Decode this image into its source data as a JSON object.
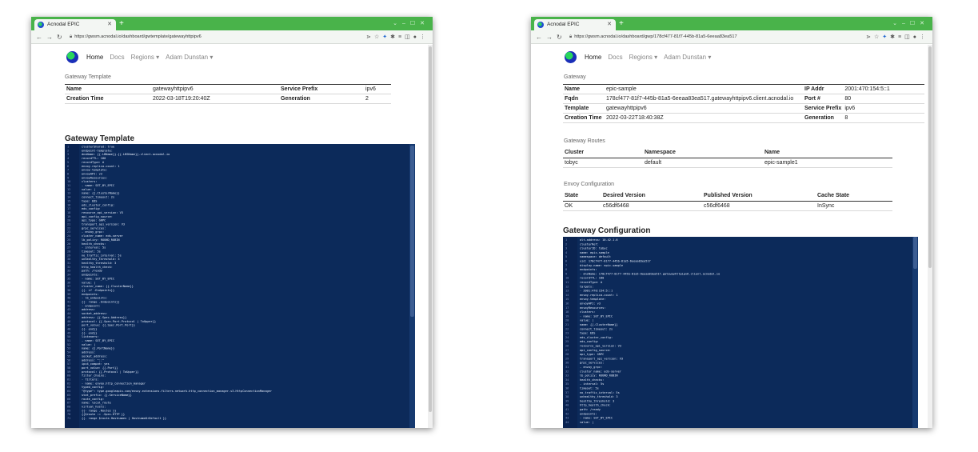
{
  "window1": {
    "tab_title": "Acnodal EPIC",
    "url": "https://gwsm.acnodal.io/dashboard/gwtemplate/gatewayhttpipv6",
    "nav": {
      "home": "Home",
      "docs": "Docs",
      "regions": "Regions ▾",
      "user": "Adam Dunstan ▾"
    },
    "section_label": "Gateway Template",
    "info": {
      "name_label": "Name",
      "name_value": "gatewayhttpipv6",
      "service_prefix_label": "Service Prefix",
      "service_prefix_value": "ipv6",
      "creation_time_label": "Creation Time",
      "creation_time_value": "2022-03-18T19:20:40Z",
      "generation_label": "Generation",
      "generation_value": "2"
    },
    "code_title": "Gateway Template",
    "code_lines": [
      "  clusterShared: true",
      "  endpoint-template:",
      "    dnsName: {{.LBName}}.{{.LBSName}}.client.acnodal.io",
      "    recordTTL: 180",
      "    recordType: A",
      "  envoy-replica-count: 1",
      "  envoy-template:",
      "    envoyAPI: v3",
      "    envoyResources:",
      "      clusters:",
      "      - name: SET_BY_EPIC",
      "        value: |",
      "          name: {{.ClusterName}}",
      "          connect_timeout: 2s",
      "          type: EDS",
      "          eds_cluster_config:",
      "            eds_config:",
      "              resource_api_version: V3",
      "              api_config_source:",
      "                api_type: GRPC",
      "                transport_api_version: V3",
      "                grpc_services:",
      "                - envoy_grpc:",
      "                    cluster_name: eds-server",
      "          lb_policy: ROUND_ROBIN",
      "          health_checks:",
      "          - interval: 5s",
      "            timeout: 5s",
      "            no_traffic_interval: 5s",
      "            unhealthy_threshold: 3",
      "            healthy_threshold: 3",
      "            http_health_check:",
      "              path: /ready",
      "      endpoints:",
      "      - name: SET_BY_EPIC",
      "        value: |",
      "          cluster_name: {{.ClusterName}}",
      "          {{- if .Endpoints}}",
      "          endpoints:",
      "          - lb_endpoints:",
      "            {{- range .Endpoints}}",
      "            - endpoint:",
      "                address:",
      "                  socket_address:",
      "                    address: {{.Spec.Address}}",
      "                    protocol: {{.Spec.Port.Protocol | ToUpper}}",
      "                    port_value: {{.Spec.Port.Port}}",
      "            {{- end}}",
      "          {{- end}}",
      "      listeners:",
      "      - name: SET_BY_EPIC",
      "        value: |",
      "          name: {{.PortName}}",
      "          address:",
      "            socket_address:",
      "              address: \"::\"",
      "              ipv4_compat: yes",
      "              port_value: {{.Port}}",
      "              protocol: {{.Protocol | ToUpper}}",
      "          filter_chains:",
      "          - filters:",
      "            - name: envoy.http_connection_manager",
      "              typed_config:",
      "                \"@type\": type.googleapis.com/envoy.extensions.filters.network.http_connection_manager.v3.HttpConnectionManager",
      "                stat_prefix: {{.ServiceName}}",
      "                route_config:",
      "                  name: local_route",
      "                  virtual_hosts:",
      "                  {{- range .Routes }}",
      "                  {{$route := .Spec.HTTP }}",
      "                  {{- range $route.Hostnames | HostnameOrDefault }}"
    ]
  },
  "window2": {
    "tab_title": "Acnodal EPIC",
    "url": "https://gwsm.acnodal.io/dashboard/gwp/178cf477-81f7-445b-81a5-6eeaa83ea517",
    "nav": {
      "home": "Home",
      "docs": "Docs",
      "regions": "Regions ▾",
      "user": "Adam Dunstan ▾"
    },
    "section_label": "Gateway",
    "info": {
      "name_label": "Name",
      "name_value": "epic-sample",
      "ip_label": "IP Addr",
      "ip_value": "2001:470:154:5::1",
      "fqdn_label": "Fqdn",
      "fqdn_value": "178cf477-81f7-445b-81a5-6eeaa83ea517.gatewayhttpipv6.client.acnodal.io",
      "port_label": "Port #",
      "port_value": "80",
      "template_label": "Template",
      "template_value": "gatewayhttpipv6",
      "service_prefix_label": "Service Prefix",
      "service_prefix_value": "ipv6",
      "creation_time_label": "Creation Time",
      "creation_time_value": "2022-03-22T18:40:38Z",
      "generation_label": "Generation",
      "generation_value": "8"
    },
    "routes_label": "Gateway Routes",
    "routes": {
      "headers": [
        "Cluster",
        "Namespace",
        "Name"
      ],
      "rows": [
        [
          "tobyc",
          "default",
          "epic-sample1"
        ]
      ]
    },
    "envoy_label": "Envoy Configuration",
    "envoy": {
      "headers": [
        "State",
        "Desired Version",
        "Published Version",
        "Cache State"
      ],
      "rows": [
        [
          "OK",
          "c56df6468",
          "c56df6468",
          "InSync"
        ]
      ]
    },
    "code_title": "Gateway Configuration",
    "code_lines": [
      "      alt-address: 10.42.1.6",
      "  clusterRef:",
      "    clusterID: tobyc",
      "    name: epic-sample",
      "    namespace: default",
      "    uid: 178cf477-81f7-445b-81a5-6eeaa83ea517",
      "  display-name: epic-sample",
      "  endpoints:",
      "  - dnsName: 178cf477-81f7-445b-81a5-6eeaa83ea517.gatewayhttpipv6.client.acnodal.io",
      "    recordTTL: 180",
      "    recordType: A",
      "    targets:",
      "    - 2001:470:154:5::1",
      "  envoy-replica-count: 1",
      "  envoy-template:",
      "    envoyAPI: v3",
      "    envoyResources:",
      "      clusters:",
      "      - name: SET_BY_EPIC",
      "        value: |",
      "          name: {{.ClusterName}}",
      "          connect_timeout: 2s",
      "          type: EDS",
      "          eds_cluster_config:",
      "            eds_config:",
      "              resource_api_version: V3",
      "              api_config_source:",
      "                api_type: GRPC",
      "                transport_api_version: V3",
      "                grpc_services:",
      "                - envoy_grpc:",
      "                    cluster_name: eds-server",
      "          lb_policy: ROUND_ROBIN",
      "          health_checks:",
      "          - interval: 5s",
      "            timeout: 5s",
      "            no_traffic_interval: 5s",
      "            unhealthy_threshold: 3",
      "            healthy_threshold: 3",
      "            http_health_check:",
      "              path: /ready",
      "      endpoints:",
      "      - name: SET_BY_EPIC",
      "        value: |"
    ]
  }
}
